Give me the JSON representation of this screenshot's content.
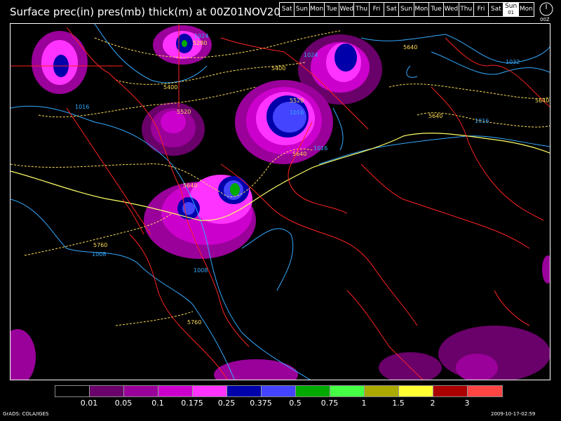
{
  "title": "Surface prec(in) pres(mb) thick(m) at 00Z01NOV2009",
  "days": [
    {
      "label": "Sat"
    },
    {
      "label": "Sun"
    },
    {
      "label": "Mon"
    },
    {
      "label": "Tue"
    },
    {
      "label": "Wed"
    },
    {
      "label": "Thu"
    },
    {
      "label": "Fri"
    },
    {
      "label": "Sat"
    },
    {
      "label": "Sun"
    },
    {
      "label": "Mon"
    },
    {
      "label": "Tue"
    },
    {
      "label": "Wed"
    },
    {
      "label": "Thu"
    },
    {
      "label": "Fri"
    },
    {
      "label": "Sat"
    },
    {
      "label": "Sun",
      "sub": "01",
      "active": true
    },
    {
      "label": "Mon"
    }
  ],
  "clock_label": "00Z",
  "legend": {
    "colors": [
      "#000000",
      "#6a006a",
      "#9a009a",
      "#cc00cc",
      "#ff33ff",
      "#0000aa",
      "#4444ff",
      "#00aa00",
      "#44ff44",
      "#aaaa00",
      "#ffff33",
      "#aa0000",
      "#ff4444"
    ],
    "ticks": [
      "0.01",
      "0.05",
      "0.1",
      "0.175",
      "0.25",
      "0.375",
      "0.5",
      "0.75",
      "1",
      "1.5",
      "2",
      "3"
    ]
  },
  "contour_labels": {
    "isobars": [
      "1024",
      "1024",
      "1032",
      "1016",
      "1016",
      "1016",
      "1016",
      "1008",
      "1008"
    ],
    "thickness": [
      "5280",
      "5400",
      "5400",
      "5520",
      "5520",
      "5640",
      "5640",
      "5640",
      "5640",
      "5640",
      "5760",
      "5760"
    ]
  },
  "footer_left": "GrADS: COLA/IGES",
  "footer_right": "2009-10-17-02:59",
  "colors": {
    "isobar": "#33aaff",
    "thickness": "#ffdd55",
    "coastline": "#ff2222",
    "frame": "#ffffff"
  }
}
